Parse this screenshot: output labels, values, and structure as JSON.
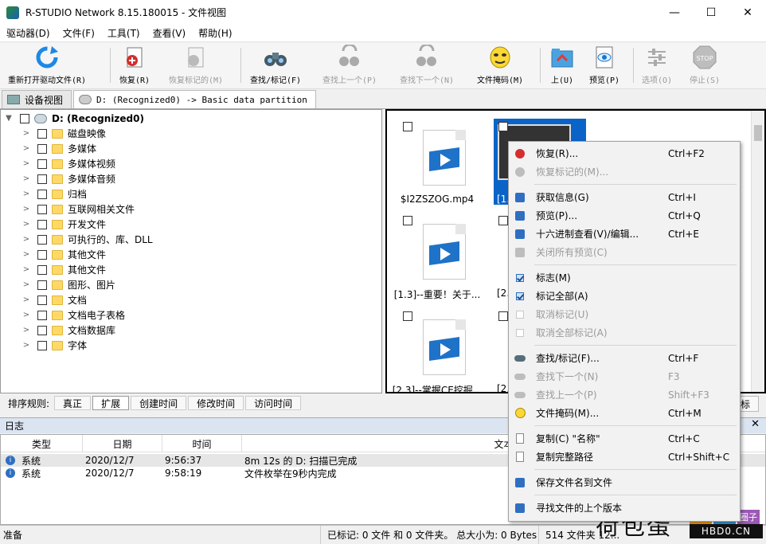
{
  "window": {
    "title": "R-STUDIO Network 8.15.180015 - 文件视图",
    "min": "—",
    "max": "☐",
    "close": "✕"
  },
  "menu": [
    "驱动器(D)",
    "文件(F)",
    "工具(T)",
    "查看(V)",
    "帮助(H)"
  ],
  "toolbar": [
    {
      "label": "重新打开驱动文件(R)",
      "icon": "refresh-icon",
      "disabled": false
    },
    {
      "label": "恢复(R)",
      "icon": "recover-icon",
      "disabled": false
    },
    {
      "label": "恢复标记的(M)",
      "icon": "recover-marked-icon",
      "disabled": true
    },
    {
      "label": "查找/标记(F)",
      "icon": "binoculars-icon",
      "disabled": false
    },
    {
      "label": "查找上一个(P)",
      "icon": "find-prev-icon",
      "disabled": true
    },
    {
      "label": "查找下一个(N)",
      "icon": "find-next-icon",
      "disabled": true
    },
    {
      "label": "文件掩码(M)",
      "icon": "mask-icon",
      "disabled": false
    },
    {
      "label": "上(U)",
      "icon": "up-folder-icon",
      "disabled": false
    },
    {
      "label": "预览(P)",
      "icon": "preview-icon",
      "disabled": false
    },
    {
      "label": "选项(O)",
      "icon": "options-icon",
      "disabled": true
    },
    {
      "label": "停止(S)",
      "icon": "stop-icon",
      "disabled": true
    }
  ],
  "stop_text": "STOP",
  "tabs": {
    "device": "设备视图",
    "current": "D: (Recognized0) -> Basic data partition"
  },
  "tree": {
    "root": "D: (Recognized0)",
    "items": [
      "磁盘映像",
      "多媒体",
      "多媒体视频",
      "多媒体音频",
      "归档",
      "互联网相关文件",
      "开发文件",
      "可执行的、库、DLL",
      "其他文件",
      "其他文件",
      "图形、图片",
      "文档",
      "文档电子表格",
      "文档数据库",
      "字体"
    ]
  },
  "files": {
    "items": [
      "$I2ZSZOG.mp4",
      "[1.",
      "[1.3]--重要！关于...",
      "[2.1",
      "[2.3]--掌握CE挖掘...",
      "[2.4"
    ]
  },
  "sortbar": {
    "label": "排序规则:",
    "options": [
      "真正",
      "扩展",
      "创建时间",
      "修改时间",
      "访问时间"
    ],
    "right": "标"
  },
  "log": {
    "title": "日志",
    "close": "✕",
    "columns": [
      "类型",
      "日期",
      "时间",
      "文本"
    ],
    "rows": [
      {
        "type": "系统",
        "date": "2020/12/7",
        "time": "9:56:37",
        "text": "8m 12s 的 D: 扫描已完成"
      },
      {
        "type": "系统",
        "date": "2020/12/7",
        "time": "9:58:19",
        "text": "文件枚举在9秒内完成"
      }
    ]
  },
  "status": {
    "ready": "准备",
    "marked": "已标记: 0 文件 和 0 文件夹。 总大小为: 0 Bytes",
    "total": "514 文件夹 12..."
  },
  "watermark": {
    "big": "荷包蛋",
    "tags": [
      "部落",
      "社区",
      "圈子"
    ],
    "site": "HBD0.CN"
  },
  "context_menu": [
    {
      "label": "恢复(R)...",
      "shortcut": "Ctrl+F2",
      "icon": "recover-icon",
      "disabled": false
    },
    {
      "label": "恢复标记的(M)...",
      "shortcut": "",
      "icon": "recover-marked-icon",
      "disabled": true
    },
    {
      "sep": true
    },
    {
      "label": "获取信息(G)",
      "shortcut": "Ctrl+I",
      "icon": "info-icon",
      "disabled": false
    },
    {
      "label": "预览(P)...",
      "shortcut": "Ctrl+Q",
      "icon": "preview-icon",
      "disabled": false
    },
    {
      "label": "十六进制查看(V)/编辑...",
      "shortcut": "Ctrl+E",
      "icon": "hex-icon",
      "disabled": false
    },
    {
      "label": "关闭所有预览(C)",
      "shortcut": "",
      "icon": "close-preview-icon",
      "disabled": true
    },
    {
      "sep": true
    },
    {
      "label": "标志(M)",
      "shortcut": "",
      "icon": "checkbox-icon",
      "disabled": false
    },
    {
      "label": "标记全部(A)",
      "shortcut": "",
      "icon": "check-all-icon",
      "disabled": false
    },
    {
      "label": "取消标记(U)",
      "shortcut": "",
      "icon": "uncheck-icon",
      "disabled": true
    },
    {
      "label": "取消全部标记(A)",
      "shortcut": "",
      "icon": "uncheck-all-icon",
      "disabled": true
    },
    {
      "sep": true
    },
    {
      "label": "查找/标记(F)...",
      "shortcut": "Ctrl+F",
      "icon": "binoculars-icon",
      "disabled": false
    },
    {
      "label": "查找下一个(N)",
      "shortcut": "F3",
      "icon": "find-next-icon",
      "disabled": true
    },
    {
      "label": "查找上一个(P)",
      "shortcut": "Shift+F3",
      "icon": "find-prev-icon",
      "disabled": true
    },
    {
      "label": "文件掩码(M)...",
      "shortcut": "Ctrl+M",
      "icon": "mask-icon",
      "disabled": false
    },
    {
      "sep": true
    },
    {
      "label": "复制(C) \"名称\"",
      "shortcut": "Ctrl+C",
      "icon": "copy-icon",
      "disabled": false
    },
    {
      "label": "复制完整路径",
      "shortcut": "Ctrl+Shift+C",
      "icon": "copy-path-icon",
      "disabled": false
    },
    {
      "sep": true
    },
    {
      "label": "保存文件名到文件",
      "shortcut": "",
      "icon": "save-list-icon",
      "disabled": false
    },
    {
      "sep": true
    },
    {
      "label": "寻找文件的上个版本",
      "shortcut": "",
      "icon": "versions-icon",
      "disabled": false
    }
  ],
  "colors": {
    "accent": "#0a64c8",
    "log_header": "#dbe5f2",
    "folder": "#ffd966"
  }
}
